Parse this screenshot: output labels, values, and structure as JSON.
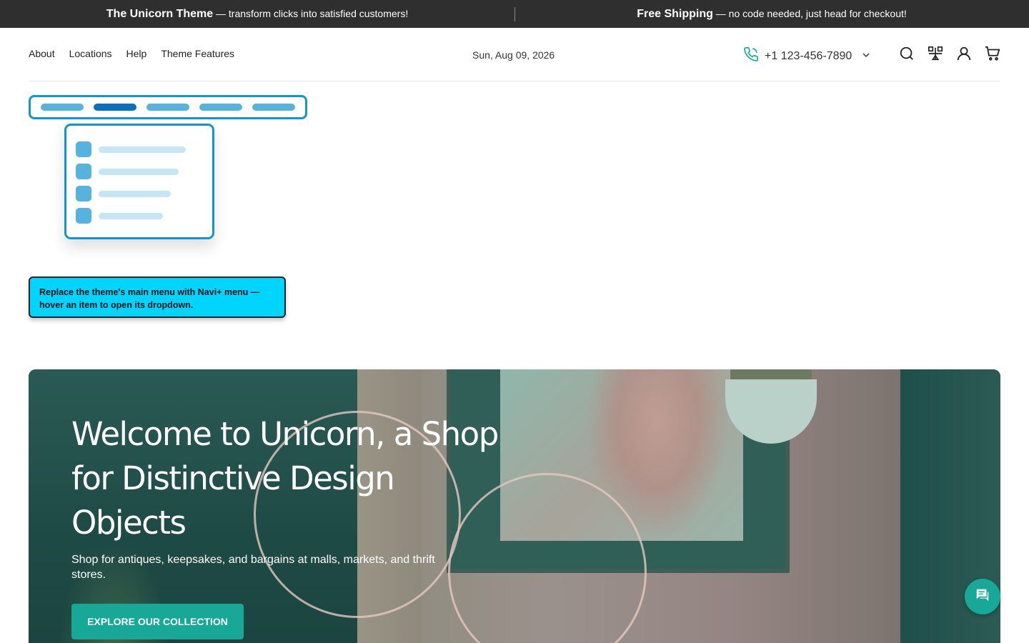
{
  "announcement": {
    "left_title": "The Unicorn Theme",
    "left_text": " — transform clicks into satisfied customers!",
    "right_title": "Free Shipping",
    "right_text": " — no code needed, just head for checkout!"
  },
  "header": {
    "nav": [
      "About",
      "Locations",
      "Help",
      "Theme Features"
    ],
    "date": "Sun, Aug 09, 2026",
    "phone": "+1 123-456-7890",
    "icons": [
      "search-icon",
      "compare-icon",
      "account-icon",
      "cart-icon"
    ]
  },
  "tooltip": {
    "text": "Replace the theme's main menu with Navi+ menu — hover an item to open its dropdown."
  },
  "hero": {
    "title": "Welcome to Unicorn, a Shop for Distinctive Design Objects",
    "subtitle": "Shop for antiques, keepsakes, and bargains at malls, markets, and thrift stores.",
    "cta": "EXPLORE OUR COLLECTION"
  },
  "colors": {
    "accent": "#17a897",
    "announcement_bg": "#2f2f2f",
    "illustration_blue": "#1397c8",
    "tooltip_bg": "#00d4ff"
  }
}
